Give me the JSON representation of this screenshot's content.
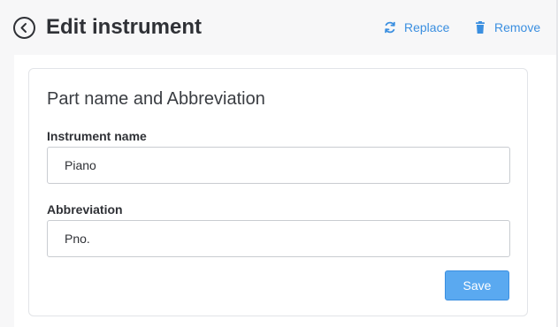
{
  "header": {
    "title": "Edit instrument",
    "back_icon": "back-arrow-circle-icon",
    "actions": {
      "replace_label": "Replace",
      "replace_icon": "refresh-icon",
      "remove_label": "Remove",
      "remove_icon": "trash-icon"
    }
  },
  "card": {
    "title": "Part name and Abbreviation",
    "fields": {
      "instrument_name": {
        "label": "Instrument name",
        "value": "Piano"
      },
      "abbreviation": {
        "label": "Abbreviation",
        "value": "Pno."
      }
    },
    "save_label": "Save"
  },
  "colors": {
    "accent": "#3b8fe0",
    "save_button_bg": "#5aa9f0",
    "page_bg": "#f7f7f8",
    "text": "#2f3136",
    "border": "#c9ccd1"
  }
}
